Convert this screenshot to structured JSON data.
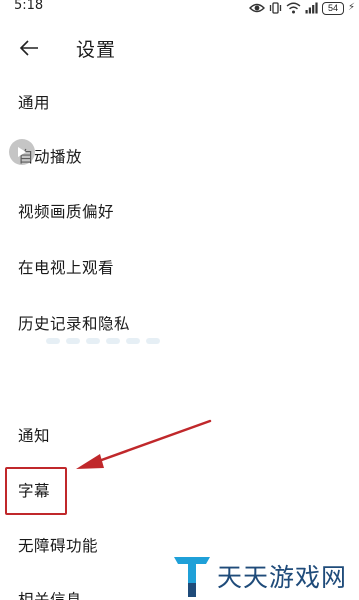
{
  "status_bar": {
    "time": "5:18",
    "battery": "54",
    "icons": [
      "eye-icon",
      "vibrate-icon",
      "wifi-icon",
      "signal-icon",
      "battery-icon",
      "charging-icon"
    ]
  },
  "header": {
    "back_icon": "arrow-left-icon",
    "title": "设置"
  },
  "menu": {
    "items": [
      {
        "label": "通用"
      },
      {
        "label": "自动播放"
      },
      {
        "label": "视频画质偏好"
      },
      {
        "label": "在电视上观看"
      },
      {
        "label": "历史记录和隐私"
      },
      {
        "label": "通知"
      },
      {
        "label": "字幕"
      },
      {
        "label": "无障碍功能"
      },
      {
        "label": "相关信息"
      }
    ]
  },
  "annotation": {
    "highlight_color": "#c0282b",
    "highlighted_item": "字幕"
  },
  "watermark": {
    "brand": "天天游戏网",
    "brand_color": "#1f4b7a",
    "accent_color": "#1fa0d8"
  }
}
